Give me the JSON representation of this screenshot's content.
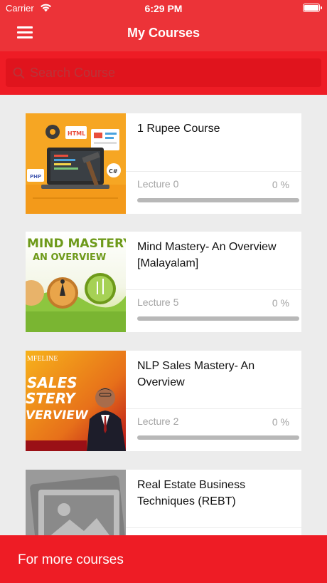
{
  "status_bar": {
    "carrier": "Carrier",
    "time": "6:29 PM",
    "wifi_icon": "wifi-icon",
    "battery_icon": "battery-full-icon"
  },
  "header": {
    "title": "My Courses",
    "menu_icon": "hamburger-menu-icon",
    "background_color": "#ec3338"
  },
  "search": {
    "placeholder": "Search Course",
    "value": "",
    "icon": "search-icon"
  },
  "courses": [
    {
      "title": "1 Rupee Course",
      "lecture_label": "Lecture 0",
      "progress_label": "0 %",
      "progress": 0,
      "thumbnail": "web-development-illustration",
      "thumbnail_text": [
        "HTML",
        "PHP",
        "C#"
      ]
    },
    {
      "title": "Mind Mastery- An Overview [Malayalam]",
      "lecture_label": "Lecture 5",
      "progress_label": "0 %",
      "progress": 0,
      "thumbnail": "mind-mastery-banner",
      "thumbnail_text": [
        "MIND MASTERY",
        "AN OVERVIEW"
      ]
    },
    {
      "title": "NLP Sales Mastery- An Overview",
      "lecture_label": "Lecture 2",
      "progress_label": "0 %",
      "progress": 0,
      "thumbnail": "sales-mastery-banner",
      "thumbnail_text": [
        "MFELINE",
        "SALES",
        "STERY",
        "VERVIEW"
      ]
    },
    {
      "title": "Real Estate Business Techniques (REBT)",
      "lecture_label": "",
      "progress_label": "",
      "progress": 0,
      "thumbnail": "image-placeholder-icon",
      "thumbnail_text": []
    }
  ],
  "footer": {
    "label": "For more courses",
    "background_color": "#ee1c25"
  },
  "colors": {
    "accent": "#ee1c25",
    "progress_track": "#b8b8b8",
    "muted_text": "#a3a3a3"
  }
}
